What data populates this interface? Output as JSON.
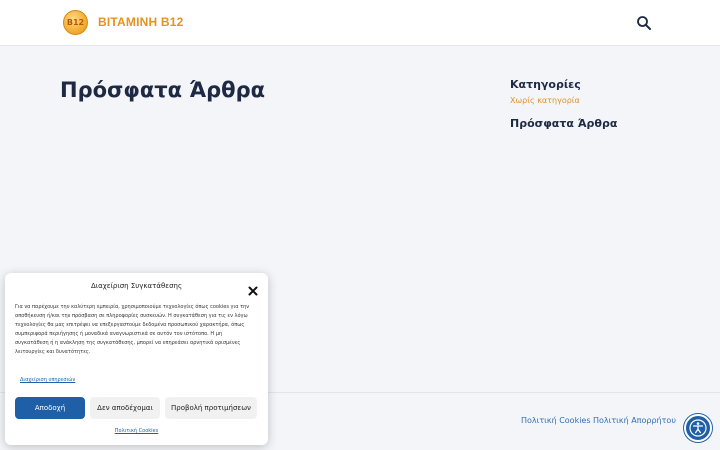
{
  "header": {
    "logo_text": "B12",
    "site_title": "ΒΙΤΑΜΙΝΗ Β12",
    "search_icon": "search-icon"
  },
  "main": {
    "page_title": "Πρόσφατα Άρθρα"
  },
  "sidebar": {
    "categories_title": "Κατηγορίες",
    "category_link": "Χωρίς κατηγορία",
    "recent_title": "Πρόσφατα Άρθρα"
  },
  "footer": {
    "cookies_link": "Πολιτική Cookies",
    "privacy_link": "Πολιτική Απορρήτου",
    "accessibility_icon": "accessibility-icon"
  },
  "consent": {
    "title": "Διαχείριση Συγκατάθεσης",
    "body": "Για να παρέχουμε την καλύτερη εμπειρία, χρησιμοποιούμε τεχνολογίες όπως cookies για την αποθήκευση ή/και την πρόσβαση σε πληροφορίες συσκευών. Η συγκατάθεση για τις εν λόγω τεχνολογίες θα μας επιτρέψει να επεξεργαστούμε δεδομένα προσωπικού χαρακτήρα, όπως συμπεριφορά περιήγησης ή μοναδικά αναγνωριστικά σε αυτόν τον ιστότοπο. Η μη συγκατάθεση ή η ανάκληση της συγκατάθεσης, μπορεί να επηρεάσει αρνητικά ορισμένες λειτουργίες και δυνατότητες.",
    "manage_link": "Διαχείριση υπηρεσιών",
    "accept_label": "Αποδοχή",
    "deny_label": "Δεν αποδέχομαι",
    "preferences_label": "Προβολή προτιμήσεων",
    "policy_link": "Πολιτική Cookies",
    "close_icon": "close-icon"
  },
  "colors": {
    "accent_orange": "#e6921e",
    "link_blue": "#1e5fa8",
    "title_dark": "#1e2a44",
    "background": "#f4f5f9"
  }
}
